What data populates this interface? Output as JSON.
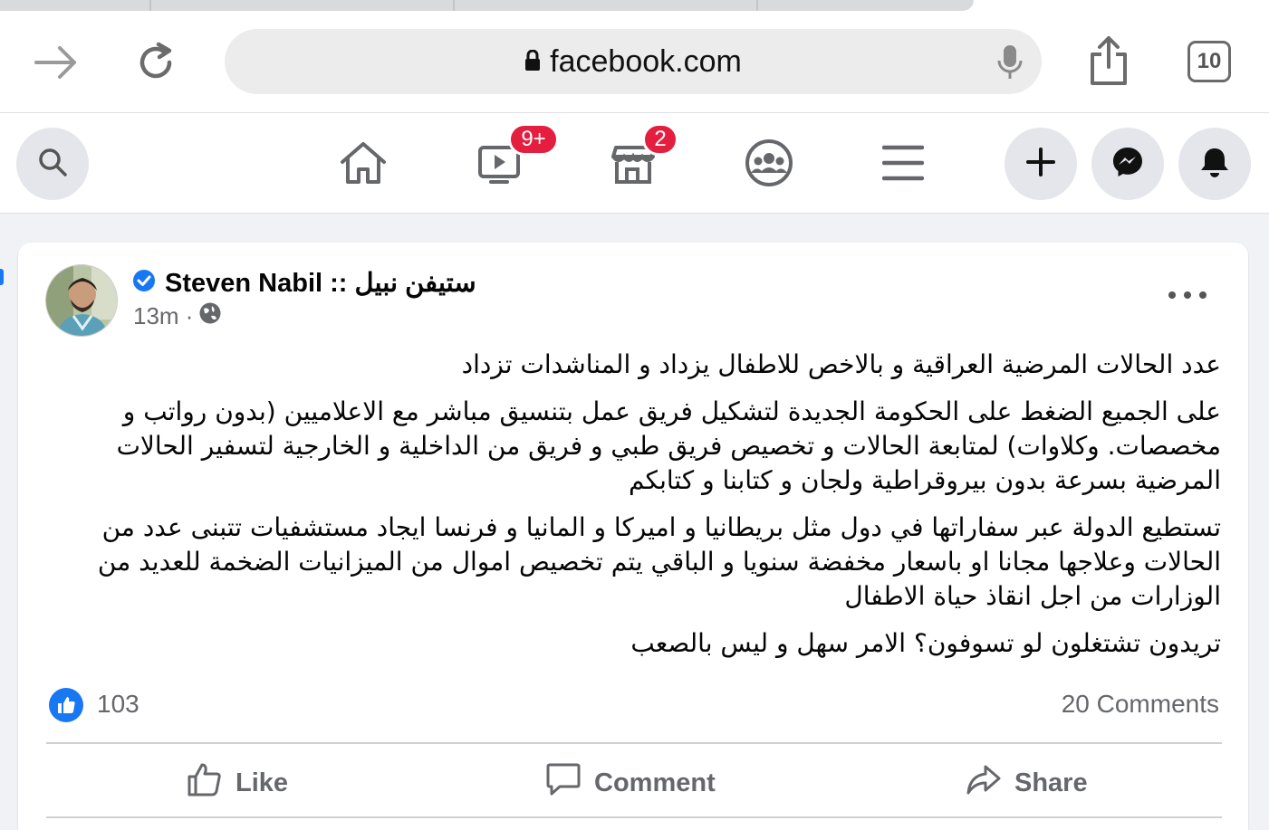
{
  "browser": {
    "url": "facebook.com",
    "tab_count": "10"
  },
  "fb_nav": {
    "watch_badge": "9+",
    "marketplace_badge": "2"
  },
  "post": {
    "author": "Steven Nabil :: ستيفن نبيل",
    "time": "13m ·",
    "paragraphs": [
      "عدد الحالات المرضية العراقية و بالاخص للاطفال يزداد و المناشدات تزداد",
      "على الجميع الضغط على الحكومة الجديدة لتشكيل فريق عمل بتنسيق مباشر مع الاعلاميين (بدون رواتب و مخصصات. وكلاوات) لمتابعة الحالات و تخصيص فريق طبي و فريق من الداخلية و الخارجية لتسفير الحالات المرضية بسرعة بدون بيروقراطية ولجان و كتابنا و كتابكم",
      "تستطيع الدولة عبر سفاراتها في دول مثل بريطانيا و اميركا و المانيا و فرنسا ايجاد مستشفيات تتبنى عدد من الحالات وعلاجها مجانا او باسعار مخفضة سنويا و الباقي يتم تخصيص اموال من الميزانيات الضخمة للعديد من الوزارات من اجل انقاذ حياة الاطفال",
      "تريدون تشتغلون لو تسوفون؟ الامر سهل و ليس بالصعب"
    ],
    "like_count": "103",
    "comments_count": "20 Comments",
    "actions": {
      "like": "Like",
      "comment": "Comment",
      "share": "Share"
    }
  },
  "colors": {
    "brand_blue": "#1877f2",
    "badge_red": "#e41e3f",
    "secondary_text": "#65676b"
  }
}
